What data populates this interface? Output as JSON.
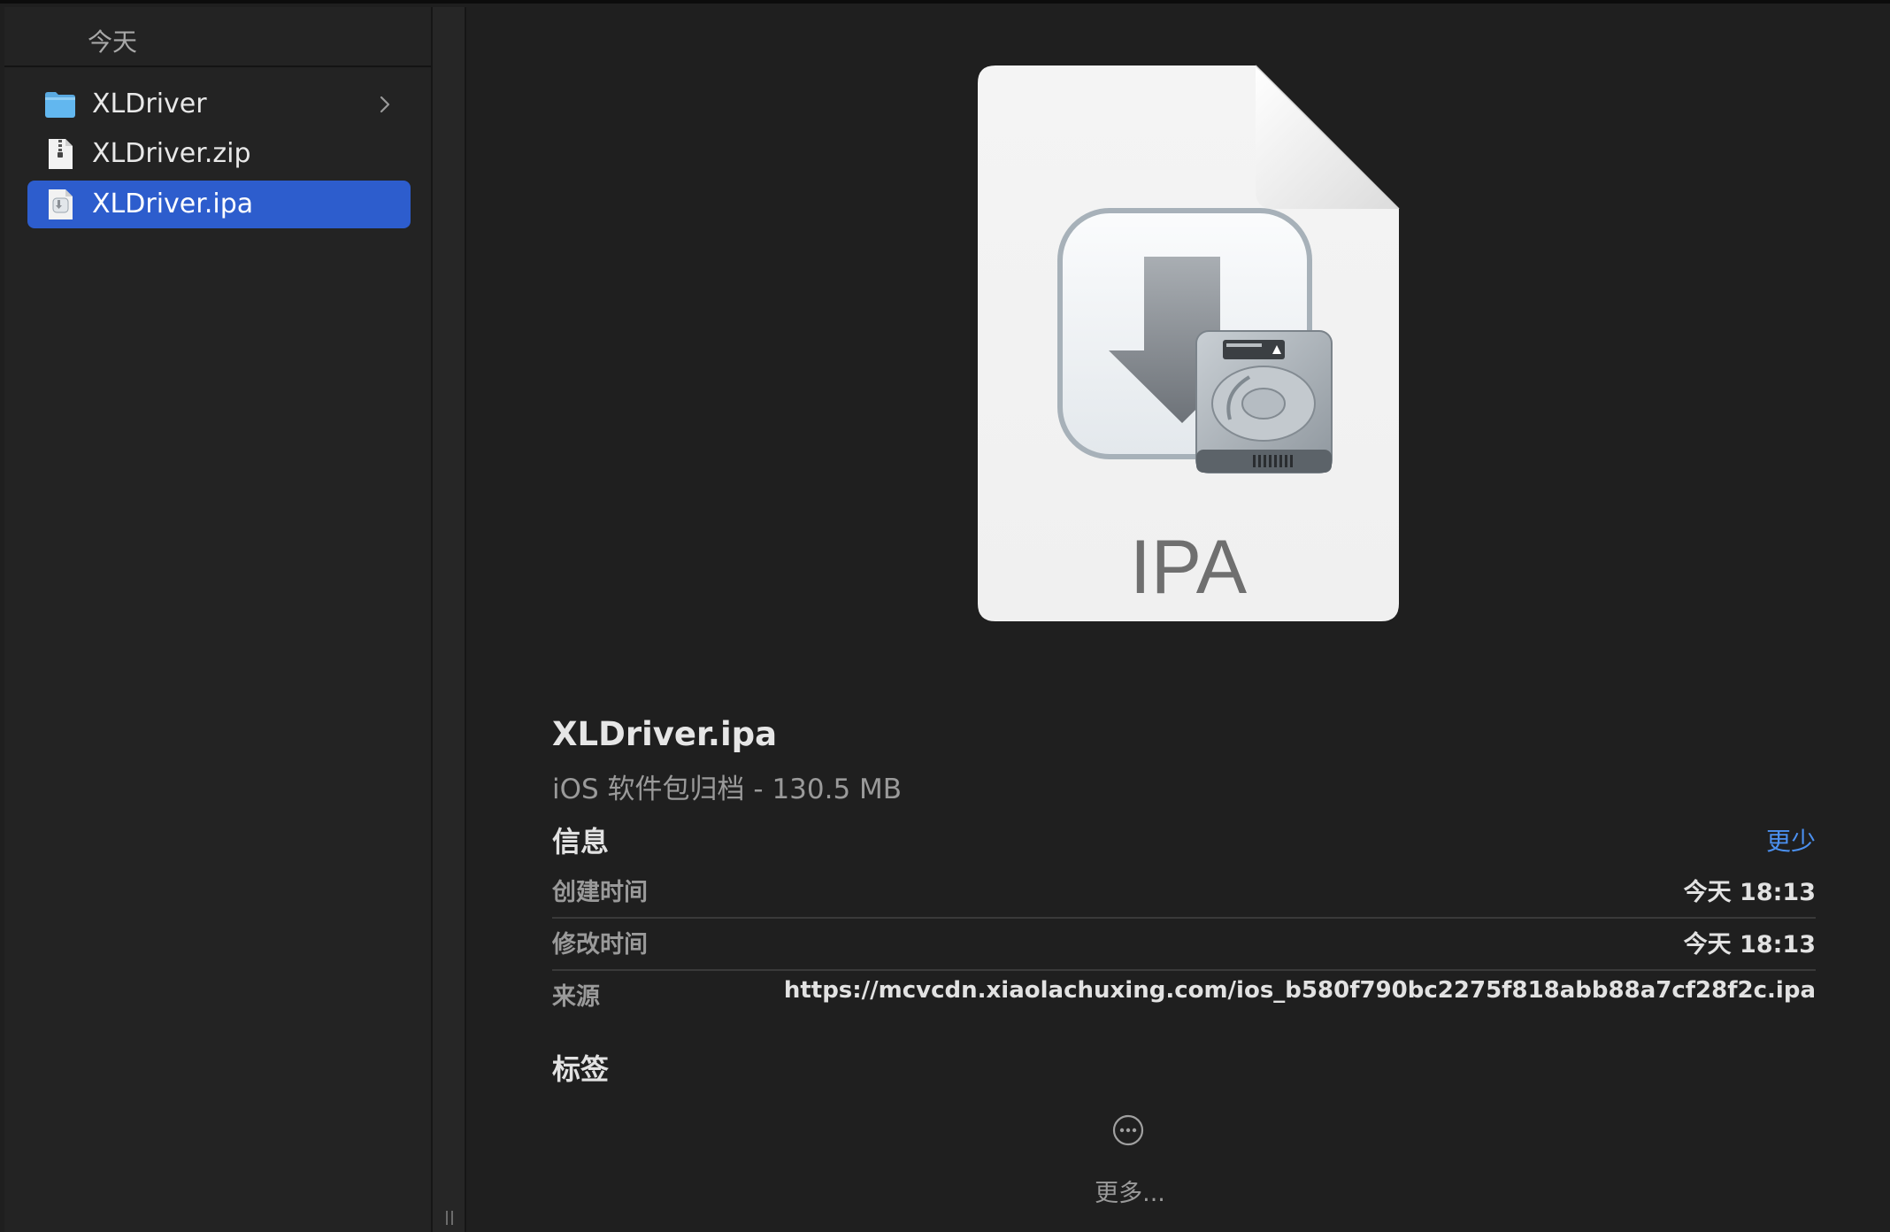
{
  "sidebar": {
    "section_title": "今天",
    "items": [
      {
        "label": "XLDriver",
        "icon": "folder-icon",
        "has_children": true,
        "selected": false
      },
      {
        "label": "XLDriver.zip",
        "icon": "zip-file-icon",
        "has_children": false,
        "selected": false
      },
      {
        "label": "XLDriver.ipa",
        "icon": "ipa-file-icon",
        "has_children": false,
        "selected": true
      }
    ]
  },
  "preview": {
    "icon_text": "IPA",
    "icon": "ipa-document-icon",
    "file_name": "XLDriver.ipa",
    "file_kind_size": "iOS 软件包归档 - 130.5 MB",
    "info": {
      "heading": "信息",
      "toggle_label": "更少",
      "rows": [
        {
          "label": "创建时间",
          "value": "今天 18:13"
        },
        {
          "label": "修改时间",
          "value": "今天 18:13"
        },
        {
          "label": "来源",
          "value": "https://mcvcdn.xiaolachuxing.com/ios_b580f790bc2275f818abb88a7cf28f2c.ipa"
        }
      ]
    },
    "tags_heading": "标签",
    "more_label": "更多..."
  },
  "colors": {
    "background": "#1f1f1f",
    "selection": "#2d5dcd",
    "link": "#4b90f0",
    "secondary_text": "#9a9a9a",
    "primary_text": "#e2e2e2"
  }
}
